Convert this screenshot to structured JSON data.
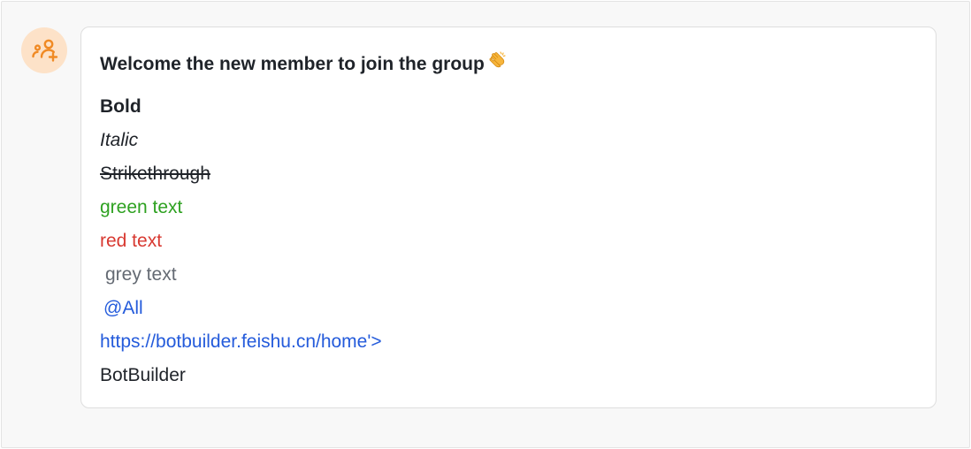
{
  "avatar": {
    "icon": "add-member-icon",
    "color": "#f08a24",
    "background": "#fde2c8"
  },
  "card": {
    "title": "Welcome the new member to join the group",
    "title_emoji": "clapping-hands-icon",
    "lines": {
      "bold": "Bold",
      "italic": "Italic",
      "strike": "Strikethrough",
      "green": "green text",
      "red": "red text",
      "grey": "grey text",
      "mention": "@All",
      "link": "https://botbuilder.feishu.cn/home'>",
      "plain": "BotBuilder"
    }
  },
  "colors": {
    "green": "#2ea121",
    "red": "#d83931",
    "grey": "#646a73",
    "link": "#245bdb"
  }
}
